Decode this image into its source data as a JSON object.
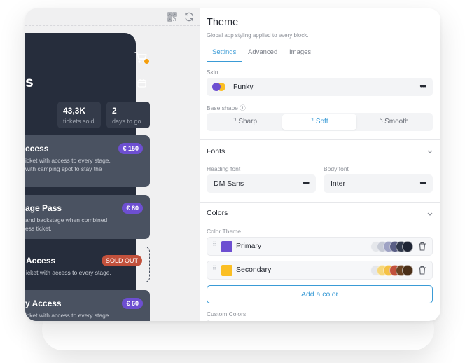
{
  "preview": {
    "toolbar": {
      "qr_icon": "qr-code-icon",
      "refresh_icon": "refresh-icon"
    },
    "app": {
      "heading_fragment": "s",
      "cart_icon": "cart-icon",
      "calendar_icon": "calendar-icon",
      "stats": [
        {
          "value": "",
          "label": ""
        },
        {
          "value": "43,3K",
          "label": "tickets sold"
        },
        {
          "value": "2",
          "label": "days to go"
        }
      ],
      "tickets": [
        {
          "title": "ccess",
          "desc_line1": "icket with access to every stage,",
          "desc_line2": " with camping spot to stay the",
          "badge": "€ 150",
          "status": "available"
        },
        {
          "title": "age Pass",
          "desc_line1": "and backstage when combined",
          "desc_line2": "ess ticket.",
          "badge": "€ 80",
          "status": "available"
        },
        {
          "title": "Access",
          "desc_line1": "icket with access to every stage.",
          "desc_line2": "",
          "badge": "SOLD OUT",
          "status": "sold-out"
        },
        {
          "title": "y Access",
          "desc_line1": "icket with access to every stage.",
          "desc_line2": "",
          "badge": "€ 60",
          "status": "available"
        }
      ]
    }
  },
  "settings": {
    "title": "Theme",
    "subtitle": "Global app styling applied to every block.",
    "tabs": [
      {
        "label": "Settings",
        "active": true
      },
      {
        "label": "Advanced",
        "active": false
      },
      {
        "label": "Images",
        "active": false
      }
    ],
    "skin": {
      "label": "Skin",
      "value": "Funky",
      "colors": [
        "#6d4fd1",
        "#fbbf24"
      ],
      "more": "•••"
    },
    "base_shape": {
      "label": "Base shape ⓘ",
      "options": [
        {
          "label": "Sharp",
          "glyph": "ℸ",
          "active": false
        },
        {
          "label": "Soft",
          "glyph": "ℸ",
          "active": true
        },
        {
          "label": "Smooth",
          "glyph": "◝",
          "active": false
        }
      ]
    },
    "fonts": {
      "title": "Fonts",
      "heading_label": "Heading font",
      "heading_value": "DM Sans",
      "body_label": "Body font",
      "body_value": "Inter",
      "more": "•••"
    },
    "colors": {
      "title": "Colors",
      "theme_label": "Color Theme",
      "items": [
        {
          "name": "Primary",
          "swatch": "#6d4fd1",
          "palette": [
            "#e5e7eb",
            "#c7cbd6",
            "#9ea2c4",
            "#5a5f86",
            "#323a4d",
            "#1f2535"
          ]
        },
        {
          "name": "Secondary",
          "swatch": "#fbbf24",
          "palette": [
            "#e5e7eb",
            "#f6d77a",
            "#f4c145",
            "#c2513c",
            "#6b4423",
            "#4a2f18"
          ]
        }
      ],
      "add_label": "Add a color",
      "custom_label": "Custom Colors"
    }
  }
}
